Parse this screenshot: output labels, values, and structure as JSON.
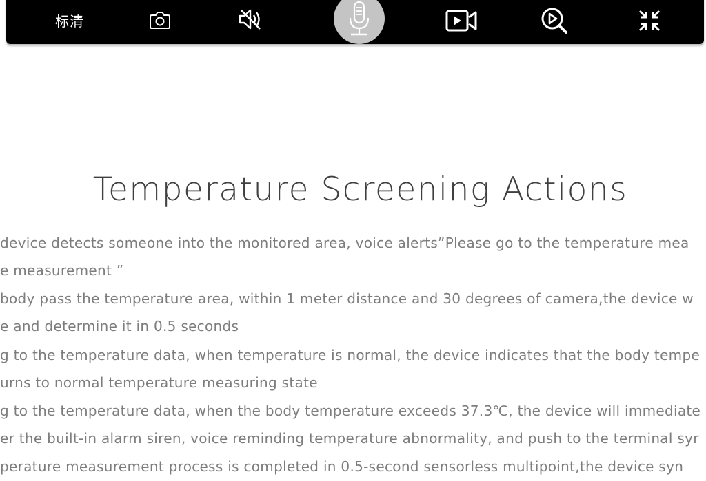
{
  "toolbar": {
    "quality_label": "标清",
    "icons": [
      "camera-icon",
      "mute-icon",
      "microphone-icon",
      "video-record-icon",
      "playback-search-icon",
      "shrink-icon"
    ],
    "background": "#000000",
    "mic_highlight": "#c4c4c4"
  },
  "article": {
    "title": "Temperature Screening Actions",
    "lines": [
      " device detects someone into the monitored area, voice alerts”Please go to the temperature mea",
      "e measurement ”",
      " body pass the temperature area, within 1 meter distance and 30 degrees of camera,the device w",
      "e and determine it in 0.5 seconds",
      "g to the temperature data, when temperature is normal, the device indicates that the body tempe",
      "urns to normal temperature measuring state",
      "g to the temperature data, when the body temperature exceeds 37.3℃, the device will immediate",
      "er the built-in alarm siren, voice reminding temperature abnormality, and push to the terminal syr",
      "perature measurement process is completed in 0.5-second sensorless multipoint,the device syn"
    ],
    "text_color": "#7d7d7d",
    "title_color": "#404040"
  }
}
